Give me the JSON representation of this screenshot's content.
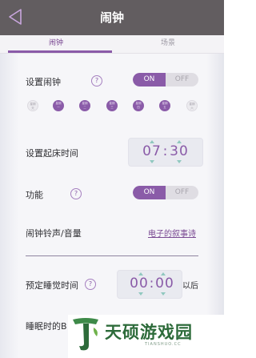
{
  "header": {
    "title": "闹钟"
  },
  "tabs": [
    {
      "label": "闹钟",
      "active": true
    },
    {
      "label": "场景",
      "active": false
    }
  ],
  "alarm": {
    "label": "设置闹钟",
    "help": "?",
    "toggle_on": "ON",
    "toggle_off": "OFF",
    "state": "ON"
  },
  "days": [
    {
      "line1": "星期",
      "line2": "天",
      "selected": false
    },
    {
      "line1": "星期",
      "line2": "一",
      "selected": true
    },
    {
      "line1": "星期",
      "line2": "二",
      "selected": true
    },
    {
      "line1": "星期",
      "line2": "三",
      "selected": true
    },
    {
      "line1": "星期",
      "line2": "四",
      "selected": true
    },
    {
      "line1": "星期",
      "line2": "五",
      "selected": true
    },
    {
      "line1": "星期",
      "line2": "六",
      "selected": false
    }
  ],
  "wake_time": {
    "label": "设置起床时间",
    "hour": "07",
    "sep": ":",
    "minute": "30"
  },
  "function": {
    "label": "功能",
    "help": "?",
    "toggle_on": "ON",
    "toggle_off": "OFF",
    "state": "ON"
  },
  "ringtone": {
    "label": "闹钟铃声/音量",
    "value": "电子的叙事诗"
  },
  "sleep": {
    "label": "预定睡觉时间",
    "help": "?",
    "hour": "00",
    "sep": ":",
    "minute": "00",
    "suffix": "以后"
  },
  "sleep_sound": {
    "label": "睡眠时的B"
  },
  "watermark": {
    "text": "天硕游戏园",
    "sub": "TIANSHUO.CC"
  },
  "colors": {
    "accent": "#8a5ba8",
    "header": "#625d60",
    "arrow": "#90c8bf"
  }
}
